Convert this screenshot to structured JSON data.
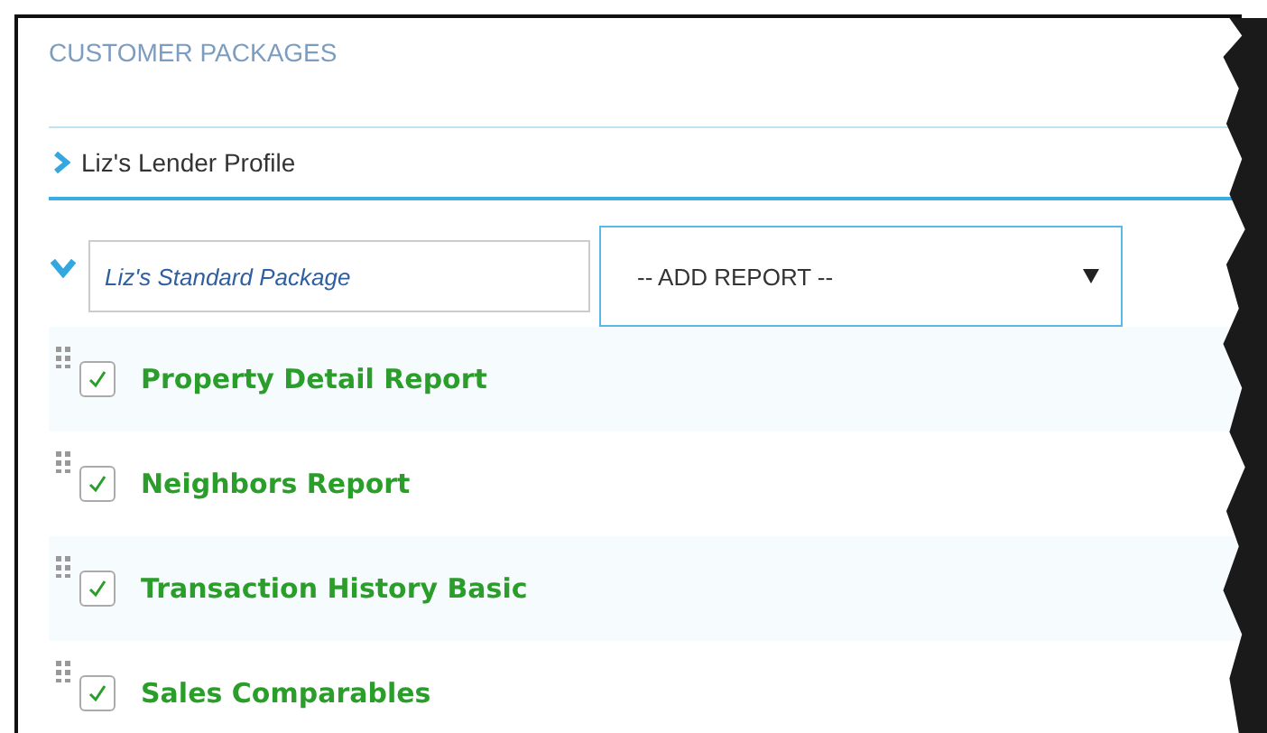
{
  "title": "CUSTOMER PACKAGES",
  "profile": {
    "label": "Liz's Lender Profile",
    "expanded": false
  },
  "package": {
    "name": "Liz's Standard Package",
    "expanded": true,
    "add_report": {
      "value": "-- ADD REPORT --"
    }
  },
  "reports": [
    {
      "label": "Property Detail Report",
      "checked": true
    },
    {
      "label": "Neighbors Report",
      "checked": true
    },
    {
      "label": "Transaction History Basic",
      "checked": true
    },
    {
      "label": "Sales Comparables",
      "checked": true
    }
  ]
}
